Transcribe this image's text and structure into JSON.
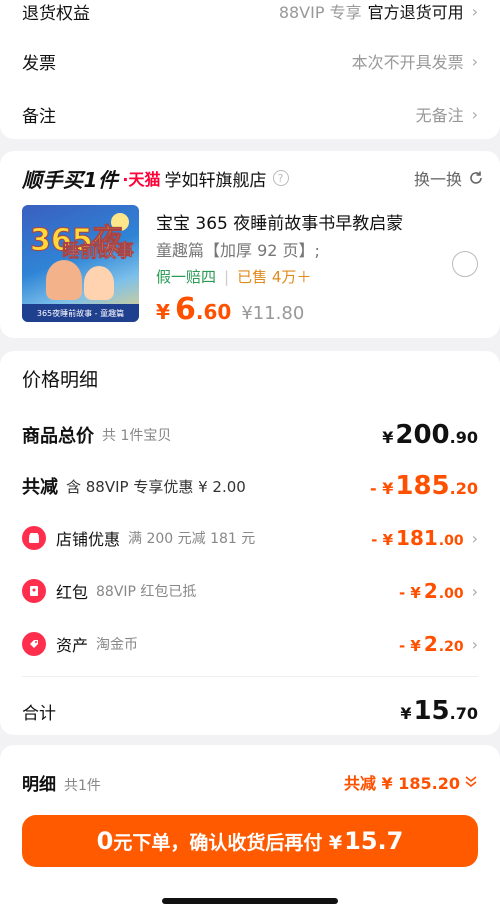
{
  "top_rows": {
    "returns": {
      "label": "退货权益",
      "tag": "88VIP 专享",
      "value": "官方退货可用"
    },
    "invoice": {
      "label": "发票",
      "value": "本次不开具发票"
    },
    "note": {
      "label": "备注",
      "value": "无备注"
    }
  },
  "shop": {
    "brand": "顺手买1件",
    "platform": "·天猫",
    "name": "学如轩旗舰店",
    "swap_label": "换一换"
  },
  "product": {
    "cover_title": "365夜",
    "cover_subtitle": "睡前故事",
    "cover_band": "365夜睡前故事 - 童趣篇",
    "title": "宝宝 365 夜睡前故事书早教启蒙",
    "subtitle": "童趣篇【加厚 92 页】;",
    "tag_fake": "假一赔四",
    "tag_sold": "已售 4万＋",
    "price_yen": "¥",
    "price_int": "6",
    "price_dec": ".60",
    "original_price": "¥11.80"
  },
  "price_detail": {
    "title": "价格明细",
    "goods_total": {
      "label": "商品总价",
      "sub": "共 1件宝贝",
      "yen": "¥",
      "int": "200",
      "dec": ".90"
    },
    "total_reduction": {
      "label": "共减",
      "sub": "含 88VIP 专享优惠 ¥ 2.00",
      "prefix": "- ¥",
      "int": "185",
      "dec": ".20"
    },
    "store_discount": {
      "label": "店铺优惠",
      "sub": "满 200 元减 181 元",
      "prefix": "- ¥",
      "int": "181",
      "dec": ".00"
    },
    "red_packet": {
      "label": "红包",
      "sub": "88VIP 红包已抵",
      "prefix": "- ¥",
      "int": "2",
      "dec": ".00"
    },
    "assets": {
      "label": "资产",
      "sub": "淘金币",
      "prefix": "- ¥",
      "int": "2",
      "dec": ".20"
    },
    "total": {
      "label": "合计",
      "yen": "¥",
      "int": "15",
      "dec": ".70"
    }
  },
  "summary": {
    "label": "明细",
    "sub": "共1件",
    "reduction": "共减 ¥ 185.20"
  },
  "cta": {
    "lead": "0",
    "text": "元下单，确认收货后再付 ¥",
    "amount": "15.7"
  },
  "colors": {
    "accent": "#ff5000",
    "cta": "#ff5a00",
    "green": "#2a9a55",
    "tmall": "#ff0036"
  },
  "icons": [
    "chevron-right-icon",
    "question-icon",
    "refresh-icon",
    "store-icon",
    "red-packet-icon",
    "coupon-icon",
    "chevron-double-down-icon"
  ]
}
